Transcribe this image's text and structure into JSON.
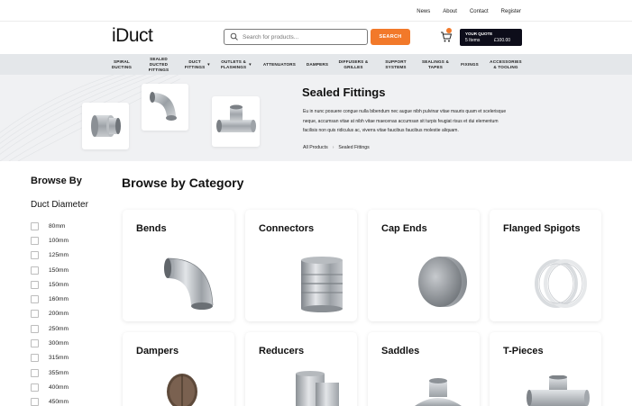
{
  "topbar": {
    "links": [
      "News",
      "About",
      "Contact",
      "Register"
    ]
  },
  "header": {
    "logo": "iDuct",
    "search_placeholder": "Search for products...",
    "search_button": "SEARCH",
    "cart_count": "",
    "quote_title": "YOUR QUOTE",
    "quote_items": "5 Items",
    "quote_total": "£100.00"
  },
  "nav": [
    "SPIRAL DUCTING",
    "SEALED DUCTED FITTINGS",
    "DUCT FITTINGS",
    "OUTLETS & FLASHINGS",
    "ATTENUATORS",
    "DAMPERS",
    "DIFFUSERS & GRILLES",
    "SUPPORT SYSTEMS",
    "SEALINGS & TAPES",
    "FIXINGS",
    "ACCESSORIES & TOOLING"
  ],
  "hero": {
    "title": "Sealed Fittings",
    "description": "Eu in nunc posuere congue nulla bibendum nec augue nibh pulvinar vitae mauris quam et scelerisque neque, accumsan vitae at nibh vitae maecenas accumsan sit turpis feugiat risus et dui elementum facilisis non quis ridiculus ac, viverra vitae faucibus faucibus molestie aliquam.",
    "breadcrumb": [
      "All Products",
      "Sealed Fittings"
    ]
  },
  "sidebar": {
    "heading": "Browse By",
    "filter_title": "Duct Diameter",
    "options": [
      "80mm",
      "100mm",
      "125mm",
      "150mm",
      "150mm",
      "160mm",
      "200mm",
      "250mm",
      "300mm",
      "315mm",
      "355mm",
      "400mm",
      "450mm"
    ]
  },
  "categories": {
    "heading": "Browse by Category",
    "items": [
      {
        "name": "Bends",
        "icon": "bend-fitting-image"
      },
      {
        "name": "Connectors",
        "icon": "connector-fitting-image"
      },
      {
        "name": "Cap Ends",
        "icon": "cap-end-image"
      },
      {
        "name": "Flanged Spigots",
        "icon": "flanged-spigot-image"
      },
      {
        "name": "Dampers",
        "icon": "damper-image"
      },
      {
        "name": "Reducers",
        "icon": "reducer-image"
      },
      {
        "name": "Saddles",
        "icon": "saddle-image"
      },
      {
        "name": "T-Pieces",
        "icon": "t-piece-image"
      }
    ]
  },
  "colors": {
    "accent": "#f2792a",
    "dark": "#0d0d1a",
    "nav_bg": "#e4e7ea",
    "hero_bg": "#f0f1f3"
  }
}
